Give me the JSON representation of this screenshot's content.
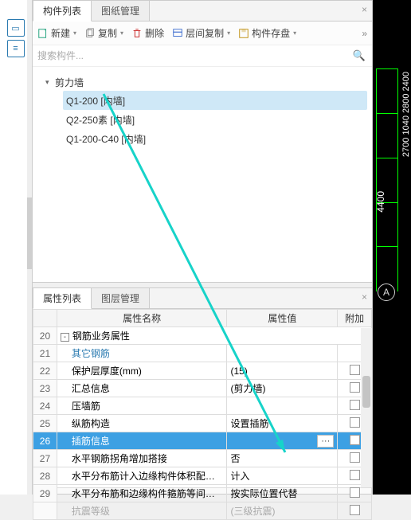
{
  "tabs_top": {
    "components": "构件列表",
    "drawings": "图纸管理"
  },
  "toolbar": {
    "new": "新建",
    "copy": "复制",
    "delete": "删除",
    "floor_copy": "层间复制",
    "save_disk": "构件存盘"
  },
  "search": {
    "placeholder": "搜索构件..."
  },
  "tree": {
    "group": "剪力墙",
    "items": [
      {
        "label": "Q1-200 [内墙]",
        "selected": true
      },
      {
        "label": "Q2-250素 [内墙]",
        "selected": false
      },
      {
        "label": "Q1-200-C40 [内墙]",
        "selected": false
      }
    ]
  },
  "tabs_bottom": {
    "props": "属性列表",
    "layers": "图层管理"
  },
  "header": {
    "name": "属性名称",
    "value": "属性值",
    "extra": "附加"
  },
  "rows": [
    {
      "idx": "20",
      "name": "钢筋业务属性",
      "value": "",
      "chk": false,
      "group": true
    },
    {
      "idx": "21",
      "name": "其它钢筋",
      "value": "",
      "chk": false,
      "link": true
    },
    {
      "idx": "22",
      "name": "保护层厚度(mm)",
      "value": "(15)",
      "chk": true
    },
    {
      "idx": "23",
      "name": "汇总信息",
      "value": "(剪力墙)",
      "chk": true
    },
    {
      "idx": "24",
      "name": "压墙筋",
      "value": "",
      "chk": true
    },
    {
      "idx": "25",
      "name": "纵筋构造",
      "value": "设置插筋",
      "chk": true
    },
    {
      "idx": "26",
      "name": "插筋信息",
      "value": "",
      "chk": true,
      "selected": true,
      "ellipsis": true
    },
    {
      "idx": "27",
      "name": "水平钢筋拐角增加搭接",
      "value": "否",
      "chk": true
    },
    {
      "idx": "28",
      "name": "水平分布筋计入边缘构件体积配箍率",
      "value": "计入",
      "chk": true
    },
    {
      "idx": "29",
      "name": "水平分布筋和边缘构件箍筋等间距时",
      "value": "按实际位置代替",
      "chk": true
    },
    {
      "idx": "",
      "name": "抗震等级",
      "value": "(三级抗震)",
      "chk": true,
      "faded": true
    }
  ],
  "cad": {
    "segments": [
      "2700",
      "1040",
      "2800",
      "2400"
    ],
    "total": "4400",
    "bubble": "A"
  }
}
